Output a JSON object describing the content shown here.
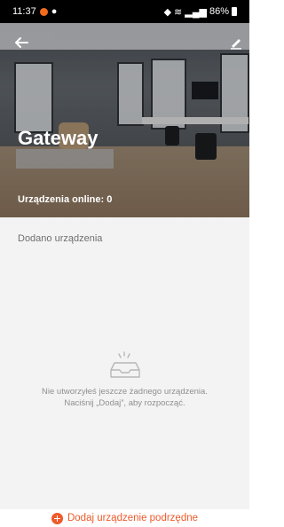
{
  "status_bar": {
    "time": "11:37",
    "signal_text": "86%"
  },
  "header": {
    "title": "Gateway",
    "online_label": "Urządzenia online: 0",
    "back_icon": "arrow-left-icon",
    "edit_icon": "pencil-icon"
  },
  "devices": {
    "section_label": "Dodano urządzenia",
    "empty_line1": "Nie utworzyłeś jeszcze żadnego urządzenia.",
    "empty_line2": "Naciśnij „Dodaj”, aby rozpocząć."
  },
  "footer": {
    "add_label": "Dodaj urządzenie podrzędne",
    "accent_color": "#ef5a2a"
  }
}
